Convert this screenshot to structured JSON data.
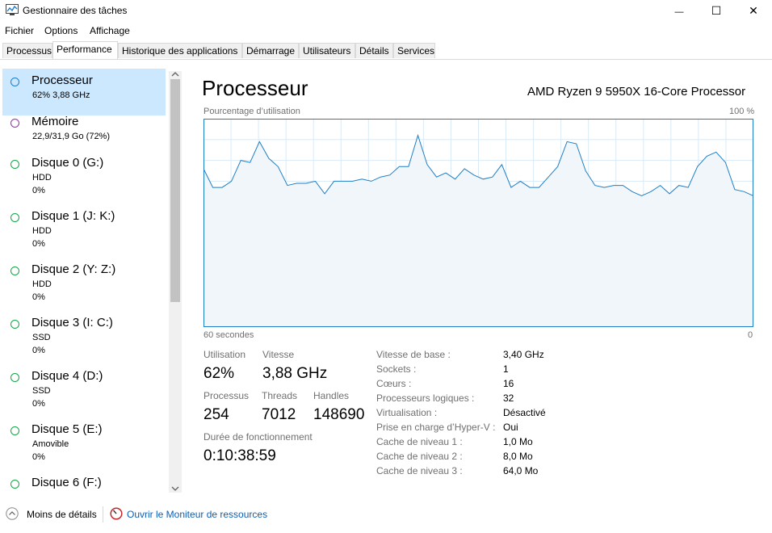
{
  "window": {
    "title": "Gestionnaire des tâches",
    "minimize": "—",
    "maximize": "☐",
    "close": "✕"
  },
  "menu": [
    "Fichier",
    "Options",
    "Affichage"
  ],
  "tabs": [
    "Processus",
    "Performance",
    "Historique des applications",
    "Démarrage",
    "Utilisateurs",
    "Détails",
    "Services"
  ],
  "active_tab": "Performance",
  "sidebar": [
    {
      "name": "Processeur",
      "line2": "62%  3,88 GHz",
      "line3": "",
      "color": "#1f7fc6",
      "selected": true
    },
    {
      "name": "Mémoire",
      "line2": "22,9/31,9 Go (72%)",
      "line3": "",
      "color": "#9b2bb0"
    },
    {
      "name": "Disque 0 (G:)",
      "line2": "HDD",
      "line3": "0%",
      "color": "#4caf50"
    },
    {
      "name": "Disque 1 (J: K:)",
      "line2": "HDD",
      "line3": "0%",
      "color": "#4caf50"
    },
    {
      "name": "Disque 2 (Y: Z:)",
      "line2": "HDD",
      "line3": "0%",
      "color": "#4caf50"
    },
    {
      "name": "Disque 3 (I: C:)",
      "line2": "SSD",
      "line3": "0%",
      "color": "#4caf50"
    },
    {
      "name": "Disque 4 (D:)",
      "line2": "SSD",
      "line3": "0%",
      "color": "#4caf50"
    },
    {
      "name": "Disque 5 (E:)",
      "line2": "Amovible",
      "line3": "0%",
      "color": "#4caf50"
    },
    {
      "name": "Disque 6 (F:)",
      "line2": "",
      "line3": "",
      "color": "#4caf50"
    }
  ],
  "main": {
    "title": "Processeur",
    "model": "AMD Ryzen 9 5950X 16-Core Processor",
    "graph_label": "Pourcentage d’utilisation",
    "graph_max": "100 %",
    "graph_time": "60 secondes",
    "graph_zero": "0"
  },
  "chart_data": {
    "type": "area",
    "y": [
      76,
      67,
      67,
      70,
      80,
      79,
      89,
      81,
      77,
      68,
      69,
      69,
      70,
      64,
      70,
      70,
      70,
      71,
      70,
      72,
      73,
      77,
      77,
      92,
      78,
      72,
      74,
      71,
      76,
      73,
      71,
      72,
      78,
      67,
      70,
      67,
      67,
      72,
      77,
      89,
      88,
      75,
      68,
      67,
      68,
      68,
      65,
      63,
      65,
      68,
      64,
      68,
      67,
      77,
      82,
      84,
      79,
      66,
      65,
      63
    ],
    "ylim": [
      0,
      100
    ],
    "x_label_left": "60 secondes",
    "x_label_right": "0",
    "color": "#1f7fc6",
    "fill": "#f1f6fa"
  },
  "stats": {
    "utilisation_label": "Utilisation",
    "utilisation": "62%",
    "vitesse_label": "Vitesse",
    "vitesse": "3,88 GHz",
    "processus_label": "Processus",
    "processus": "254",
    "threads_label": "Threads",
    "threads": "7012",
    "handles_label": "Handles",
    "handles": "148690",
    "uptime_label": "Durée de fonctionnement",
    "uptime": "0:10:38:59"
  },
  "specs": [
    {
      "label": "Vitesse de base :",
      "value": "3,40 GHz"
    },
    {
      "label": "Sockets :",
      "value": "1"
    },
    {
      "label": "Cœurs :",
      "value": "16"
    },
    {
      "label": "Processeurs logiques :",
      "value": "32"
    },
    {
      "label": "Virtualisation :",
      "value": "Désactivé"
    },
    {
      "label": "Prise en charge d’Hyper-V :",
      "value": "Oui"
    },
    {
      "label": "Cache de niveau 1 :",
      "value": "1,0 Mo"
    },
    {
      "label": "Cache de niveau 2 :",
      "value": "8,0 Mo"
    },
    {
      "label": "Cache de niveau 3 :",
      "value": "64,0 Mo"
    }
  ],
  "footer": {
    "less_details": "Moins de détails",
    "monitor_link": "Ouvrir le Moniteur de ressources"
  }
}
